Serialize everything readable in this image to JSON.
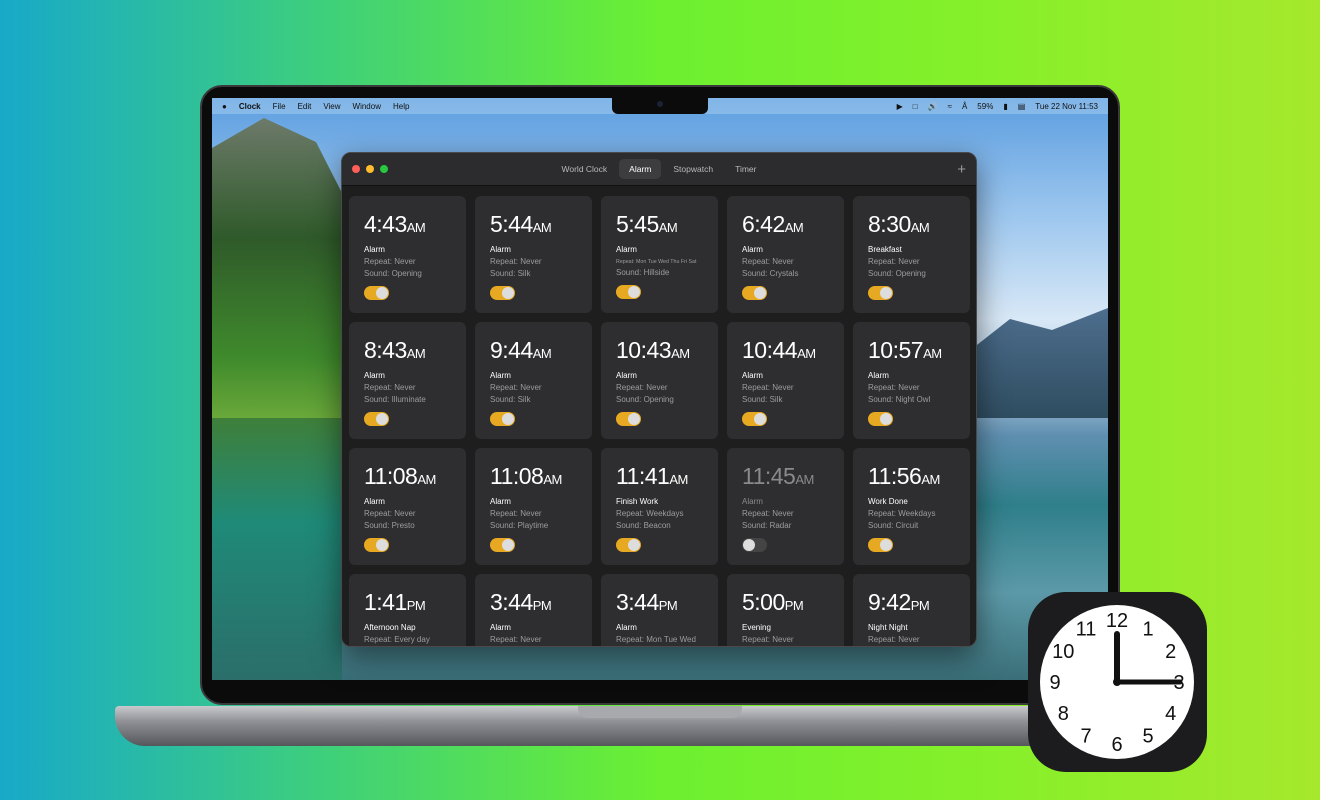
{
  "menubar": {
    "app": "Clock",
    "items": [
      "File",
      "Edit",
      "View",
      "Window",
      "Help"
    ],
    "battery": "59%",
    "datetime": "Tue 22 Nov  11:53"
  },
  "window": {
    "tabs": [
      "World Clock",
      "Alarm",
      "Stopwatch",
      "Timer"
    ],
    "active_tab": "Alarm",
    "add_icon": "plus-icon"
  },
  "colors": {
    "toggle_on": "#e8a922",
    "card": "#2e2e30"
  },
  "alarms": [
    {
      "time": "4:43",
      "ampm": "AM",
      "label": "Alarm",
      "repeat": "Repeat: Never",
      "sound": "Sound: Opening",
      "on": true
    },
    {
      "time": "5:44",
      "ampm": "AM",
      "label": "Alarm",
      "repeat": "Repeat: Never",
      "sound": "Sound: Silk",
      "on": true
    },
    {
      "time": "5:45",
      "ampm": "AM",
      "label": "Alarm",
      "repeat": "Repeat: Mon Tue Wed Thu Fri Sat",
      "sound": "Sound: Hillside",
      "on": true
    },
    {
      "time": "6:42",
      "ampm": "AM",
      "label": "Alarm",
      "repeat": "Repeat: Never",
      "sound": "Sound: Crystals",
      "on": true
    },
    {
      "time": "8:30",
      "ampm": "AM",
      "label": "Breakfast",
      "repeat": "Repeat: Never",
      "sound": "Sound: Opening",
      "on": true
    },
    {
      "time": "8:43",
      "ampm": "AM",
      "label": "Alarm",
      "repeat": "Repeat: Never",
      "sound": "Sound: Illuminate",
      "on": true
    },
    {
      "time": "9:44",
      "ampm": "AM",
      "label": "Alarm",
      "repeat": "Repeat: Never",
      "sound": "Sound: Silk",
      "on": true
    },
    {
      "time": "10:43",
      "ampm": "AM",
      "label": "Alarm",
      "repeat": "Repeat: Never",
      "sound": "Sound: Opening",
      "on": true
    },
    {
      "time": "10:44",
      "ampm": "AM",
      "label": "Alarm",
      "repeat": "Repeat: Never",
      "sound": "Sound: Silk",
      "on": true
    },
    {
      "time": "10:57",
      "ampm": "AM",
      "label": "Alarm",
      "repeat": "Repeat: Never",
      "sound": "Sound: Night Owl",
      "on": true
    },
    {
      "time": "11:08",
      "ampm": "AM",
      "label": "Alarm",
      "repeat": "Repeat: Never",
      "sound": "Sound: Presto",
      "on": true
    },
    {
      "time": "11:08",
      "ampm": "AM",
      "label": "Alarm",
      "repeat": "Repeat: Never",
      "sound": "Sound: Playtime",
      "on": true
    },
    {
      "time": "11:41",
      "ampm": "AM",
      "label": "Finish Work",
      "repeat": "Repeat: Weekdays",
      "sound": "Sound: Beacon",
      "on": true
    },
    {
      "time": "11:45",
      "ampm": "AM",
      "label": "Alarm",
      "repeat": "Repeat: Never",
      "sound": "Sound: Radar",
      "on": false
    },
    {
      "time": "11:56",
      "ampm": "AM",
      "label": "Work Done",
      "repeat": "Repeat: Weekdays",
      "sound": "Sound: Circuit",
      "on": true
    },
    {
      "time": "1:41",
      "ampm": "PM",
      "label": "Afternoon Nap",
      "repeat": "Repeat: Every day",
      "sound": "",
      "on": true
    },
    {
      "time": "3:44",
      "ampm": "PM",
      "label": "Alarm",
      "repeat": "Repeat: Never",
      "sound": "",
      "on": true
    },
    {
      "time": "3:44",
      "ampm": "PM",
      "label": "Alarm",
      "repeat": "Repeat: Mon Tue Wed",
      "sound": "",
      "on": true
    },
    {
      "time": "5:00",
      "ampm": "PM",
      "label": "Evening",
      "repeat": "Repeat: Never",
      "sound": "",
      "on": true
    },
    {
      "time": "9:42",
      "ampm": "PM",
      "label": "Night Night",
      "repeat": "Repeat: Never",
      "sound": "",
      "on": true
    }
  ],
  "clock_icon": {
    "numbers": [
      "12",
      "1",
      "2",
      "3",
      "4",
      "5",
      "6",
      "7",
      "8",
      "9",
      "10",
      "11"
    ],
    "time_shown": "12:15"
  }
}
